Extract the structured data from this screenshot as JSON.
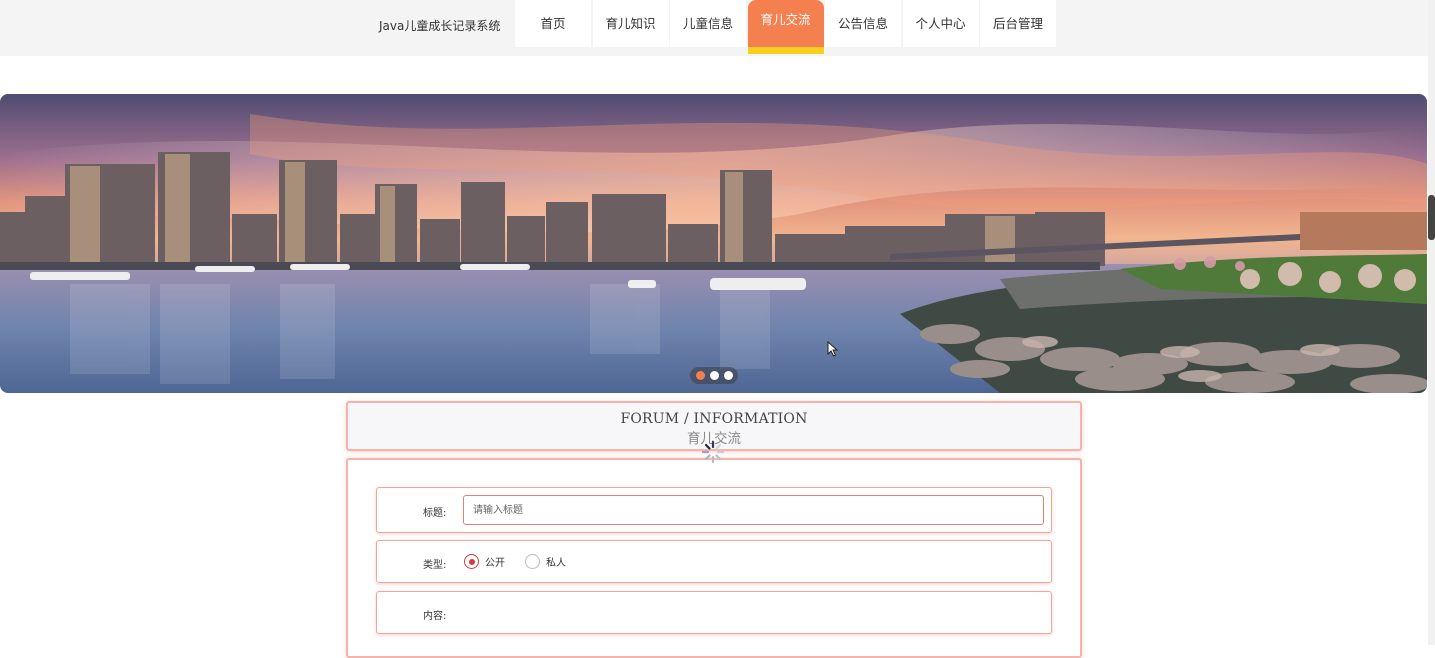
{
  "header": {
    "site_title": "Java儿童成长记录系统",
    "nav": [
      {
        "label": "首页",
        "active": false
      },
      {
        "label": "育儿知识",
        "active": false
      },
      {
        "label": "儿童信息",
        "active": false
      },
      {
        "label": "育儿交流",
        "active": true
      },
      {
        "label": "公告信息",
        "active": false
      },
      {
        "label": "个人中心",
        "active": false
      },
      {
        "label": "后台管理",
        "active": false
      }
    ]
  },
  "banner": {
    "slides": 3,
    "active_slide": 1
  },
  "section": {
    "title_en": "FORUM / INFORMATION",
    "title_cn": "育儿交流"
  },
  "form": {
    "title_label": "标题:",
    "title_placeholder": "请输入标题",
    "title_value": "",
    "type_label": "类型:",
    "type_options": [
      "公开",
      "私人"
    ],
    "type_selected": "公开",
    "content_label": "内容:"
  },
  "colors": {
    "accent": "#f4804f",
    "accent_underline": "#f7cf1f",
    "panel_border": "#f6b3ac",
    "radio_checked": "#d23b3b"
  },
  "icons": {
    "loading": "spinner-icon",
    "cursor": "mouse-pointer-icon"
  }
}
